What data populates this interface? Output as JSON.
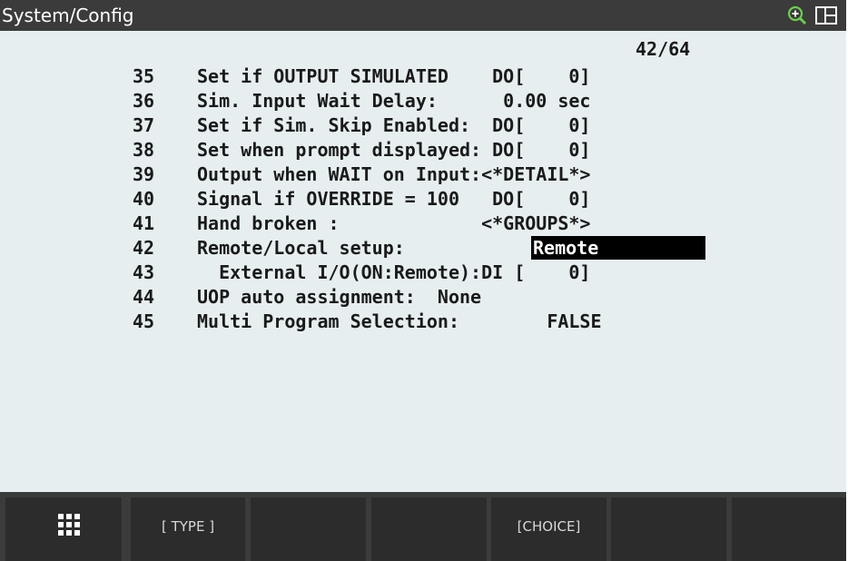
{
  "window": {
    "title": "System/Config"
  },
  "icons": {
    "zoom": "zoom-in-icon",
    "layout": "split-window-icon",
    "menu": "grid-menu-icon"
  },
  "colors": {
    "titlebar": "#3b3b3b",
    "content_bg": "#e6eef0",
    "softkey_bg": "#2c2c2c",
    "highlight_bg": "#000000"
  },
  "page_indicator": "42/64",
  "rows": [
    {
      "num": "35",
      "text": "Set if OUTPUT SIMULATED    DO[    0]"
    },
    {
      "num": "36",
      "text": "Sim. Input Wait Delay:      0.00 sec"
    },
    {
      "num": "37",
      "text": "Set if Sim. Skip Enabled:  DO[    0]"
    },
    {
      "num": "38",
      "text": "Set when prompt displayed: DO[    0]"
    },
    {
      "num": "39",
      "text": "Output when WAIT on Input:<*DETAIL*>"
    },
    {
      "num": "40",
      "text": "Signal if OVERRIDE = 100   DO[    0]"
    },
    {
      "num": "41",
      "text": "Hand broken :             <*GROUPS*>"
    },
    {
      "num": "42",
      "text": "Remote/Local setup:",
      "value": "Remote"
    },
    {
      "num": "43",
      "text": "  External I/O(ON:Remote):DI [    0]"
    },
    {
      "num": "44",
      "text": "UOP auto assignment:  None"
    },
    {
      "num": "45",
      "text": "Multi Program Selection:        FALSE"
    }
  ],
  "softkeys": [
    "",
    "[ TYPE ]",
    "",
    "",
    "[CHOICE]",
    "",
    ""
  ]
}
